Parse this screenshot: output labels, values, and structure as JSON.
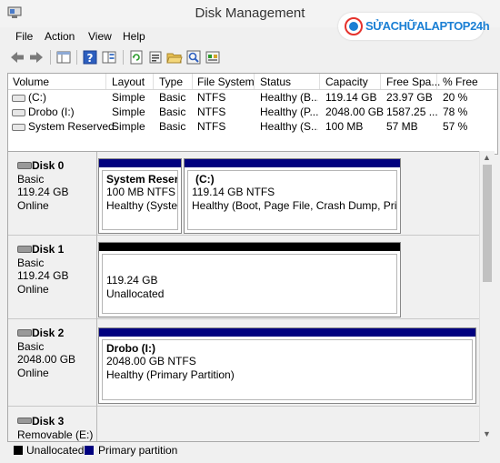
{
  "window": {
    "title": "Disk Management"
  },
  "watermark": {
    "text": "SỬACHỮALAPTOP24h",
    "accent": "#1a7fd4"
  },
  "menu": [
    "File",
    "Action",
    "View",
    "Help"
  ],
  "toolbar_icons": [
    "back-arrow-icon",
    "forward-arrow-icon",
    "console-tree-icon",
    "help-icon",
    "help-topics-icon",
    "refresh-icon",
    "properties-icon",
    "open-folder-icon",
    "search-icon",
    "check-disk-icon"
  ],
  "volumes": {
    "columns": [
      "Volume",
      "Layout",
      "Type",
      "File System",
      "Status",
      "Capacity",
      "Free Spa...",
      "% Free"
    ],
    "rows": [
      [
        "(C:)",
        "Simple",
        "Basic",
        "NTFS",
        "Healthy (B...",
        "119.14 GB",
        "23.97 GB",
        "20 %"
      ],
      [
        "Drobo (I:)",
        "Simple",
        "Basic",
        "NTFS",
        "Healthy (P...",
        "2048.00 GB",
        "1587.25 ...",
        "78 %"
      ],
      [
        "System Reserved",
        "Simple",
        "Basic",
        "NTFS",
        "Healthy (S...",
        "100 MB",
        "57 MB",
        "57 %"
      ]
    ]
  },
  "disks": [
    {
      "name": "Disk 0",
      "type": "Basic",
      "size": "119.24 GB",
      "status": "Online",
      "partitions": [
        {
          "name": "System Reserve",
          "size_fs": "100 MB NTFS",
          "status": "Healthy (System"
        },
        {
          "name": "(C:)",
          "size_fs": "119.14 GB NTFS",
          "status": "Healthy (Boot, Page File, Crash Dump, Primar"
        }
      ]
    },
    {
      "name": "Disk 1",
      "type": "Basic",
      "size": "119.24 GB",
      "status": "Online",
      "partitions": [
        {
          "size": "119.24 GB",
          "status": "Unallocated"
        }
      ]
    },
    {
      "name": "Disk 2",
      "type": "Basic",
      "size": "2048.00 GB",
      "status": "Online",
      "partitions": [
        {
          "name": "Drobo  (I:)",
          "size_fs": "2048.00 GB NTFS",
          "status": "Healthy (Primary Partition)"
        }
      ]
    },
    {
      "name": "Disk 3",
      "type": "Removable (E:)"
    }
  ],
  "legend": {
    "unallocated": "Unallocated",
    "primary": "Primary partition"
  },
  "colors": {
    "primary_bar": "#00007f",
    "unallocated_bar": "#000000"
  }
}
